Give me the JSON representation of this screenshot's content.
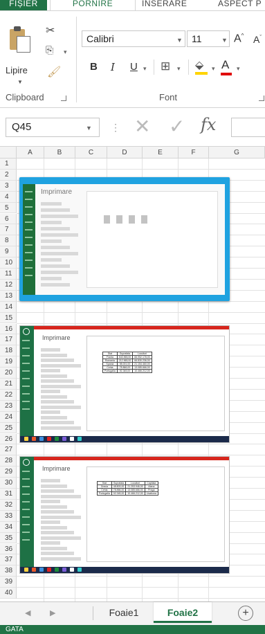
{
  "ribbon": {
    "tabs": [
      "FIȘIER",
      "PORNIRE",
      "INSERARE",
      "ASPECT P"
    ],
    "clipboard": {
      "paste_label": "Lipire",
      "group_label": "Clipboard"
    },
    "font": {
      "name": "Calibri",
      "size": "11",
      "group_label": "Font"
    }
  },
  "formula_bar": {
    "name_box": "Q45"
  },
  "grid": {
    "columns": [
      "A",
      "B",
      "C",
      "D",
      "E",
      "F",
      "G"
    ],
    "rows": [
      "1",
      "2",
      "3",
      "4",
      "5",
      "6",
      "7",
      "8",
      "9",
      "10",
      "11",
      "12",
      "13",
      "14",
      "15",
      "16",
      "17",
      "18",
      "19",
      "20",
      "21",
      "22",
      "23",
      "24",
      "25",
      "26",
      "27",
      "28",
      "29",
      "30",
      "31",
      "32",
      "33",
      "34",
      "35",
      "36",
      "37",
      "38",
      "39",
      "40"
    ]
  },
  "shots": {
    "s1_title": "Imprimare",
    "s2_title": "Imprimare",
    "s3_title": "Imprimare",
    "table1": [
      [
        "Stat",
        "Suprafata",
        "Locuitori"
      ],
      [
        "Franta",
        "543.965,00",
        "66.952.178,00"
      ],
      [
        "Romania",
        "212.965,00",
        "66.830.236,00"
      ],
      [
        "Spania",
        "98.001,00",
        "21.154.460,00"
      ],
      [
        "Cehia",
        "78.866,00",
        "13.085.666,00"
      ],
      [
        "Portugalia",
        "92.345,00",
        "10.466.212,00"
      ]
    ],
    "table2": [
      [
        "Stat",
        "Suprafata",
        "Locuitori",
        "Capitala"
      ],
      [
        "Grecia",
        "48.803,00",
        "21.253.946,00",
        "Atena"
      ],
      [
        "Cehia",
        "78.866,00",
        "13.085.666,00",
        "Praga"
      ],
      [
        "Portugalia",
        "92.345,00",
        "10.466.212,00",
        "Lisabona"
      ]
    ]
  },
  "sheets": {
    "tab1": "Foaie1",
    "tab2": "Foaie2",
    "add": "+"
  },
  "status": {
    "text": "GATA"
  },
  "colors": {
    "excel_green": "#217346",
    "selection_blue": "#1fa2e0"
  }
}
